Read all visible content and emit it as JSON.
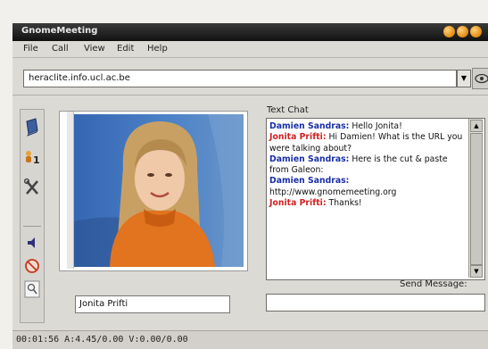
{
  "window": {
    "title": "GnomeMeeting"
  },
  "menu": {
    "items": [
      {
        "label": "File"
      },
      {
        "label": "Call"
      },
      {
        "label": "View"
      },
      {
        "label": "Edit"
      },
      {
        "label": "Help"
      }
    ]
  },
  "address": {
    "value": "heraclite.info.ucl.ac.be"
  },
  "video": {
    "remote_name": "Jonita Prifti"
  },
  "chat": {
    "label": "Text Chat",
    "messages": [
      {
        "author": "Damien Sandras:",
        "text": " Hello Jonita!"
      },
      {
        "author": "Jonita Prifti:",
        "text": " Hi Damien! What is the URL you were talking about?"
      },
      {
        "author": "Damien Sandras:",
        "text": " Here is the cut & paste from Galeon:"
      },
      {
        "author": "Damien Sandras:",
        "text": " http://www.gnomemeeting.org"
      },
      {
        "author": "Jonita Prifti:",
        "text": " Thanks!"
      }
    ],
    "send_label": "Send Message:",
    "send_value": ""
  },
  "status": {
    "text": "00:01:56  A:4.45/0.00  V:0.00/0.00"
  },
  "colors": {
    "damien": "#1a2fa8",
    "jonita": "#d22121",
    "titlebar": "#1f1f1f"
  }
}
